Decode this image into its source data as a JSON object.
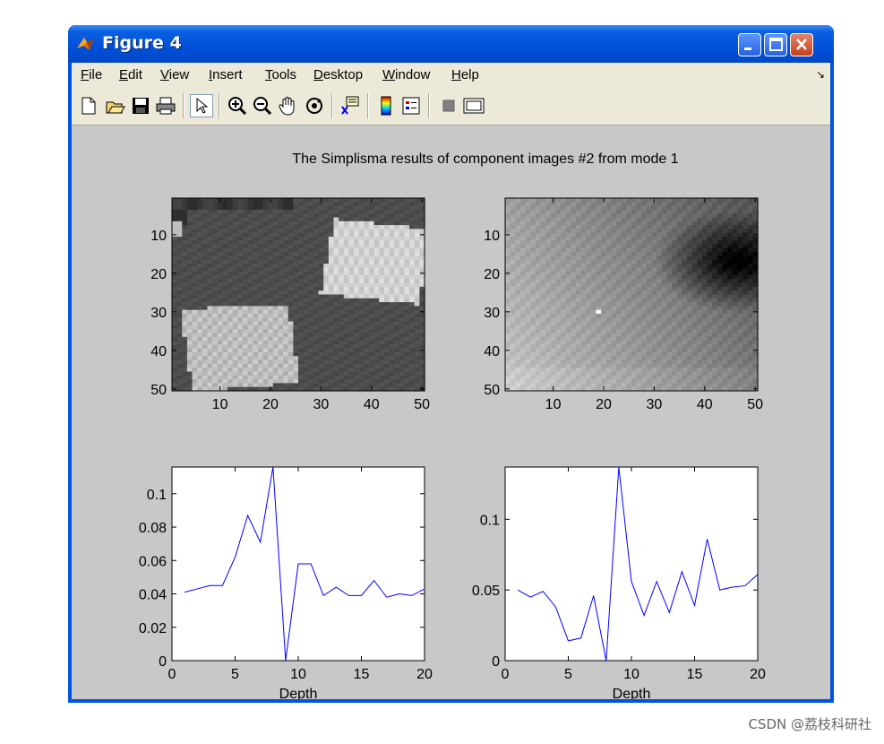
{
  "window": {
    "title": "Figure 4",
    "menus": [
      {
        "label": "File",
        "mnemonic": "F",
        "rest": "ile"
      },
      {
        "label": "Edit",
        "mnemonic": "E",
        "rest": "dit"
      },
      {
        "label": "View",
        "mnemonic": "V",
        "rest": "iew"
      },
      {
        "label": "Insert",
        "mnemonic": "I",
        "rest": "nsert"
      },
      {
        "label": "Tools",
        "mnemonic": "T",
        "rest": "ools"
      },
      {
        "label": "Desktop",
        "mnemonic": "D",
        "rest": "esktop"
      },
      {
        "label": "Window",
        "mnemonic": "W",
        "rest": "indow"
      },
      {
        "label": "Help",
        "mnemonic": "H",
        "rest": "elp"
      }
    ],
    "menu_arrow": "↘",
    "toolbar_icons": [
      "new-file-icon",
      "open-folder-icon",
      "save-icon",
      "print-icon",
      "pointer-icon",
      "zoom-in-icon",
      "zoom-out-icon",
      "pan-hand-icon",
      "rotate-3d-icon",
      "data-cursor-icon",
      "colorbar-icon",
      "legend-icon",
      "hide-plot-tools-icon",
      "show-plot-tools-icon"
    ]
  },
  "figure": {
    "title": "The Simplisma results of component images #2 from mode 1",
    "accent_line": "#0000ff",
    "background": "#c8c8c8"
  },
  "chart_data": [
    {
      "type": "heatmap",
      "title": "",
      "xticks": [
        10,
        20,
        30,
        40,
        50
      ],
      "yticks": [
        10,
        20,
        30,
        40,
        50
      ],
      "xlim": [
        0.5,
        50.5
      ],
      "ylim": [
        0.5,
        50.5
      ],
      "colormap": "gray",
      "description_values": "grayscale image 50x50: dark background, bright rotated squares at top-right and bottom-left"
    },
    {
      "type": "heatmap",
      "title": "",
      "xticks": [
        10,
        20,
        30,
        40,
        50
      ],
      "yticks": [
        10,
        20,
        30,
        40,
        50
      ],
      "xlim": [
        0.5,
        50.5
      ],
      "ylim": [
        0.5,
        50.5
      ],
      "colormap": "gray"
    },
    {
      "type": "line",
      "xlabel": "Depth",
      "ylabel": "",
      "xlim": [
        0,
        20
      ],
      "ylim": [
        0,
        0.116
      ],
      "xticks": [
        "0",
        "5",
        "10",
        "15",
        "20"
      ],
      "yticks": [
        "0",
        "0.02",
        "0.04",
        "0.06",
        "0.08",
        "0.1"
      ],
      "x": [
        1,
        2,
        3,
        4,
        5,
        6,
        7,
        8,
        9,
        10,
        11,
        12,
        13,
        14,
        15,
        16,
        17,
        18,
        19,
        20
      ],
      "series": [
        {
          "values": [
            0.041,
            0.043,
            0.045,
            0.045,
            0.062,
            0.087,
            0.071,
            0.116,
            0.0,
            0.058,
            0.058,
            0.039,
            0.044,
            0.039,
            0.039,
            0.048,
            0.038,
            0.04,
            0.039,
            0.043
          ]
        }
      ]
    },
    {
      "type": "line",
      "xlabel": "Depth",
      "ylabel": "",
      "xlim": [
        0,
        20
      ],
      "ylim": [
        0,
        0.137
      ],
      "xticks": [
        "0",
        "5",
        "10",
        "15",
        "20"
      ],
      "yticks": [
        "0",
        "0.05",
        "0.1"
      ],
      "x": [
        1,
        2,
        3,
        4,
        5,
        6,
        7,
        8,
        9,
        10,
        11,
        12,
        13,
        14,
        15,
        16,
        17,
        18,
        19,
        20
      ],
      "series": [
        {
          "values": [
            0.05,
            0.045,
            0.049,
            0.038,
            0.014,
            0.016,
            0.046,
            0.0,
            0.137,
            0.056,
            0.032,
            0.056,
            0.034,
            0.063,
            0.039,
            0.086,
            0.05,
            0.052,
            0.053,
            0.061
          ]
        }
      ]
    }
  ],
  "watermark": "CSDN @荔枝科研社"
}
